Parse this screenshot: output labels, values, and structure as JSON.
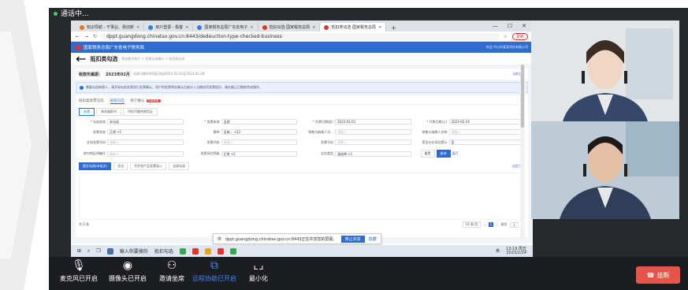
{
  "call": {
    "status": "通话中..."
  },
  "browser": {
    "tabs": [
      {
        "label": "知识导航 - 干事业、靠创新",
        "active": false
      },
      {
        "label": "用户登录 - 极客",
        "active": false
      },
      {
        "label": "国家税务总局广东省电子",
        "active": false
      },
      {
        "label": "抵扣勾选 国家税务总局",
        "active": false
      },
      {
        "label": "抵扣类勾选 国家税务总局",
        "active": true
      }
    ],
    "new_tab": "+",
    "url": "dppt.guangdong.chinatax.gov.cn:8443/dedeuction-type-checked-business",
    "profile_pill": "更新"
  },
  "site": {
    "name": "国家税务总局广东省电子税务局",
    "right_text": "欢迎 中山市某某科技有限公司"
  },
  "page": {
    "title": "抵扣类勾选",
    "breadcrumb": "税务数字账户 > 发票勾选确认 > 抵扣类勾选"
  },
  "period": {
    "label": "税款所属期：",
    "value": "2023年02月",
    "note": "勾选可操作时间区间自2023-01-01至2023-02-28",
    "link": "当前状态"
  },
  "notice": {
    "text": "需要勾选纳税人，请开始勾选发票进行发票确认，用户的发票将在确认后被计入当期进项发票抵扣，请在截止日期前完成操作。",
    "close": "×"
  },
  "subtabs": [
    {
      "label": "抵扣类发票勾选",
      "active": false
    },
    {
      "label": "抵扣勾选",
      "active": true
    },
    {
      "label": "统计确认",
      "active": false,
      "badge": "有新数据"
    }
  ],
  "sel_tabs": [
    {
      "label": "发票",
      "active": true
    },
    {
      "label": "海关缴款书",
      "active": false
    },
    {
      "label": "代扣代缴完税凭证",
      "active": false
    }
  ],
  "fields": [
    {
      "label": "* 勾选状态",
      "value": "未勾选"
    },
    {
      "label": "* 发票来源",
      "value": "全部"
    },
    {
      "label": "* 开票日期(起)",
      "value": "2023-02-01"
    },
    {
      "label": "* 开票日期(止)",
      "value": "2023-02-24"
    },
    {
      "label": "发票状态",
      "value": "正常  +1"
    },
    {
      "label": "票种",
      "value": "全电...  +12"
    },
    {
      "label": "销售方纳税人识...",
      "value": "请输入",
      "placeholder": true
    },
    {
      "label": "销售方纳税人名称",
      "value": "请输入",
      "placeholder": true
    },
    {
      "label": "全电发票号码",
      "value": "请输入",
      "placeholder": true
    },
    {
      "label": "发票代码",
      "value": "请输入",
      "placeholder": true
    },
    {
      "label": "发票号码",
      "value": "请输入",
      "placeholder": true
    },
    {
      "label": "是否存在风险提示",
      "value": "否"
    },
    {
      "label": "转内销证明编号",
      "value": "请输入",
      "placeholder": true
    },
    {
      "label": "发票风险等级",
      "value": "正常  +2"
    },
    {
      "label": "业务类型",
      "value": "请选择  +1"
    },
    {
      "label": "",
      "value": ""
    }
  ],
  "buttons": {
    "submit": "提交勾选(本批次)",
    "export": "导出",
    "query": "代开农产品发票录入",
    "more": "全部勾选",
    "reset": "重置",
    "search": "查询",
    "expand": "展开",
    "custom": "自定义列"
  },
  "pager": {
    "total": "共 0 条",
    "per_page": "10 条/页",
    "page": "1",
    "goto": "前往",
    "goto_page": "1",
    "page_unit": "页"
  },
  "share": {
    "text": "dppt.guangdong.chinatax.gov.cn:8443正在共享您的屏幕。",
    "stop": "停止共享",
    "hide": "隐藏"
  },
  "taskbar": {
    "app_label": "输入你要搜的",
    "app2": "抵扣勾选",
    "ime": "英",
    "time": "13:19 周五",
    "date": "2023/2/24"
  },
  "controls": [
    {
      "label": "麦克风已开启",
      "icon": "microphone-icon"
    },
    {
      "label": "摄像头已开启",
      "icon": "camera-icon"
    },
    {
      "label": "邀请坐席",
      "icon": "invite-user-icon"
    },
    {
      "label": "远程协助已开启",
      "icon": "remote-assist-icon",
      "active": true
    },
    {
      "label": "最小化",
      "icon": "minimize-icon"
    }
  ],
  "hangup": "挂断",
  "colors": {
    "accent": "#2e6cd1",
    "hangup": "#e8534a",
    "call_bg": "#26282c",
    "active_control": "#3f86ff"
  }
}
